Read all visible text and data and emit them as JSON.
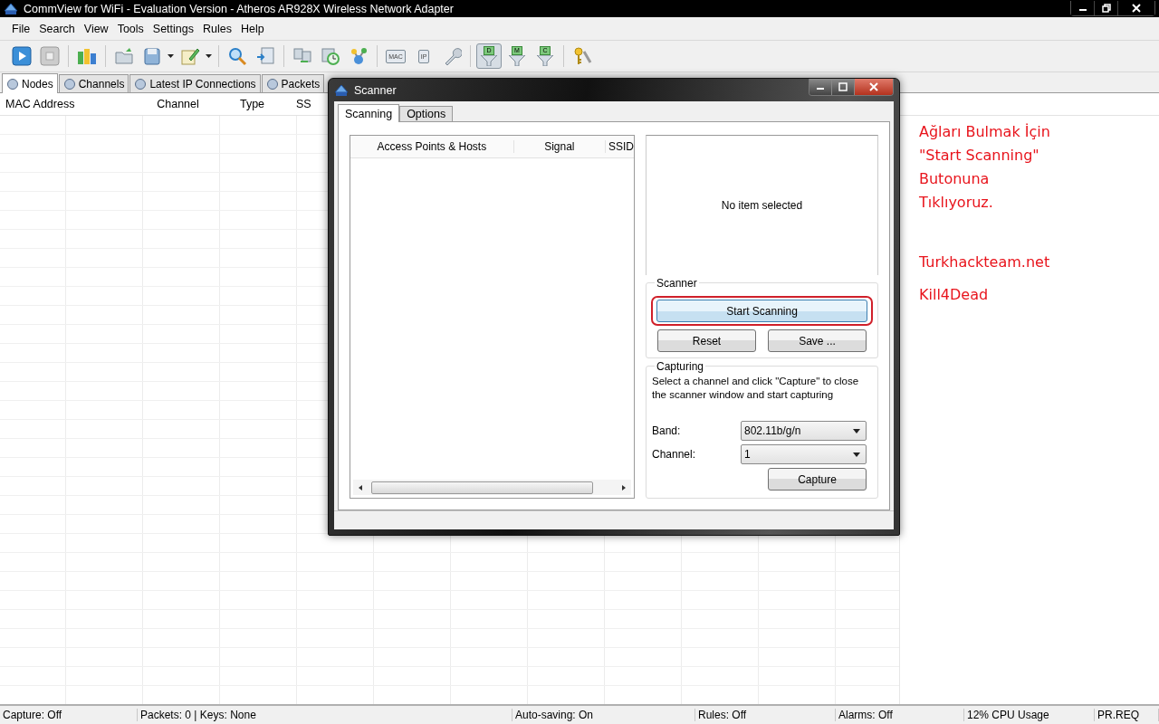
{
  "window": {
    "title": "CommView for WiFi - Evaluation Version - Atheros AR928X Wireless Network Adapter"
  },
  "menu": [
    "File",
    "Search",
    "View",
    "Tools",
    "Settings",
    "Rules",
    "Help"
  ],
  "toolbar": [
    {
      "kind": "play"
    },
    {
      "kind": "stop"
    },
    {
      "kind": "separator"
    },
    {
      "kind": "chart"
    },
    {
      "kind": "separator"
    },
    {
      "kind": "folder"
    },
    {
      "kind": "save"
    },
    {
      "kind": "caret"
    },
    {
      "kind": "pen"
    },
    {
      "kind": "caret"
    },
    {
      "kind": "separator"
    },
    {
      "kind": "search"
    },
    {
      "kind": "doc"
    },
    {
      "kind": "separator"
    },
    {
      "kind": "nodes"
    },
    {
      "kind": "clock"
    },
    {
      "kind": "molecule"
    },
    {
      "kind": "separator"
    },
    {
      "kind": "netbox",
      "label": "MAC"
    },
    {
      "kind": "netbox",
      "label": "IP"
    },
    {
      "kind": "wrench"
    },
    {
      "kind": "separator"
    },
    {
      "kind": "filter",
      "label": "D",
      "selected": true
    },
    {
      "kind": "filter",
      "label": "M",
      "selected": false
    },
    {
      "kind": "filter",
      "label": "C",
      "selected": false
    },
    {
      "kind": "separator"
    },
    {
      "kind": "key"
    }
  ],
  "tabs": [
    {
      "label": "Nodes",
      "selected": true
    },
    {
      "label": "Channels",
      "selected": false
    },
    {
      "label": "Latest IP Connections",
      "selected": false
    },
    {
      "label": "Packets",
      "selected": false
    }
  ],
  "table": {
    "columns": [
      "MAC Address",
      "Channel",
      "Type",
      "SS"
    ]
  },
  "dialog": {
    "title": "Scanner",
    "tabs": [
      {
        "label": "Scanning",
        "selected": true
      },
      {
        "label": "Options",
        "selected": false
      }
    ],
    "list_columns": [
      "Access Points & Hosts",
      "Signal",
      "SSID"
    ],
    "details": {
      "message": "No item selected"
    },
    "scanner_group": {
      "title": "Scanner",
      "buttons": [
        {
          "label": "Start Scanning",
          "highlighted": true
        },
        {
          "label": "Reset",
          "highlighted": false
        },
        {
          "label": "Save ...",
          "highlighted": false
        }
      ]
    },
    "capturing_group": {
      "title": "Capturing",
      "hint": "Select a channel and click \"Capture\" to close the scanner window and start capturing",
      "fields": [
        {
          "label": "Band:",
          "value": "802.11b/g/n"
        },
        {
          "label": "Channel:",
          "value": "1"
        }
      ],
      "button": "Capture"
    }
  },
  "annotation": {
    "lines": [
      "Ağları Bulmak İçin",
      "\"Start Scanning\"",
      "Butonuna",
      "Tıklıyoruz."
    ],
    "site": "Turkhackteam.net",
    "author": "Kill4Dead"
  },
  "status_bar": [
    "Capture: Off",
    "Packets: 0 | Keys: None",
    "Auto-saving: On",
    "Rules: Off",
    "Alarms: Off",
    "12% CPU Usage",
    "PR.REQ"
  ]
}
